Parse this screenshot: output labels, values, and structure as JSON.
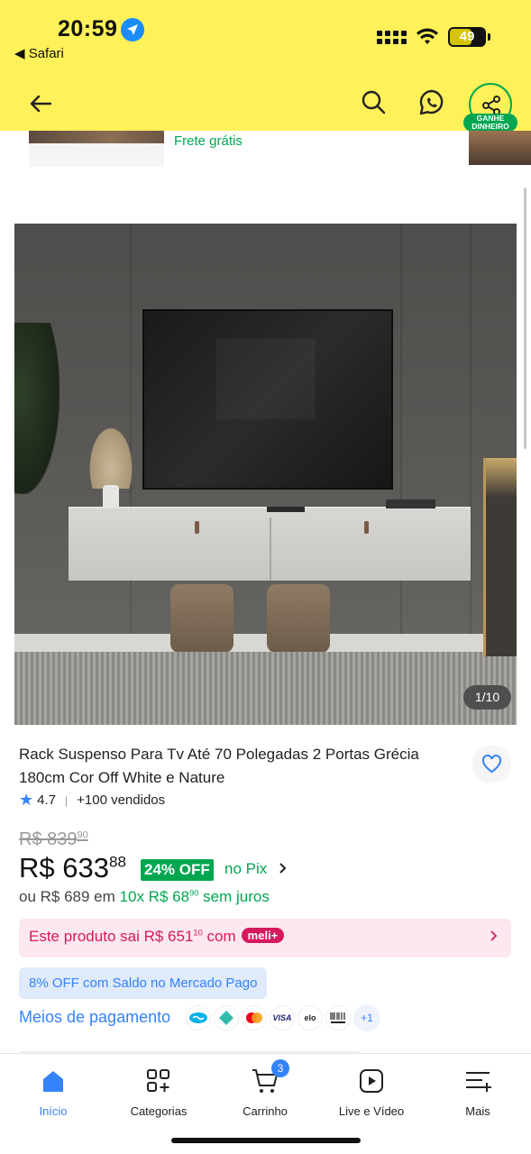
{
  "status_bar": {
    "time": "20:59",
    "back_app": "◀ Safari",
    "battery": "49"
  },
  "header": {
    "share_badge": "GANHE DINHEIRO"
  },
  "carousel_strip": {
    "shipping": "Frete grátis"
  },
  "gallery": {
    "counter": "1/10"
  },
  "product": {
    "title": "Rack Suspenso Para Tv Até 70 Polegadas 2 Portas Grécia 180cm Cor Off White e Nature",
    "rating": "4.7",
    "sold": "+100 vendidos",
    "old_price_main": "R$ 839",
    "old_price_cents": "90",
    "price_main": "R$ 633",
    "price_cents": "88",
    "discount": "24% OFF",
    "pix_label": "no Pix",
    "install_prefix": "ou R$ 689 em",
    "install_main": "10x R$ 68",
    "install_cents": "90",
    "install_suffix": "sem juros"
  },
  "meli": {
    "prefix": "Este produto sai R$ 651",
    "cents": "10",
    "mid": "com",
    "pill": "meli+"
  },
  "saldo": "8% OFF com Saldo no Mercado Pago",
  "payment": {
    "label": "Meios de pagamento",
    "more": "+1"
  },
  "tabs": [
    {
      "label": "Início"
    },
    {
      "label": "Categorias"
    },
    {
      "label": "Carrinho",
      "badge": "3"
    },
    {
      "label": "Live e Vídeo"
    },
    {
      "label": "Mais"
    }
  ],
  "colors": {
    "header": "#fff159",
    "accent": "#3483fa",
    "green": "#00a650",
    "pink": "#d6185e"
  }
}
